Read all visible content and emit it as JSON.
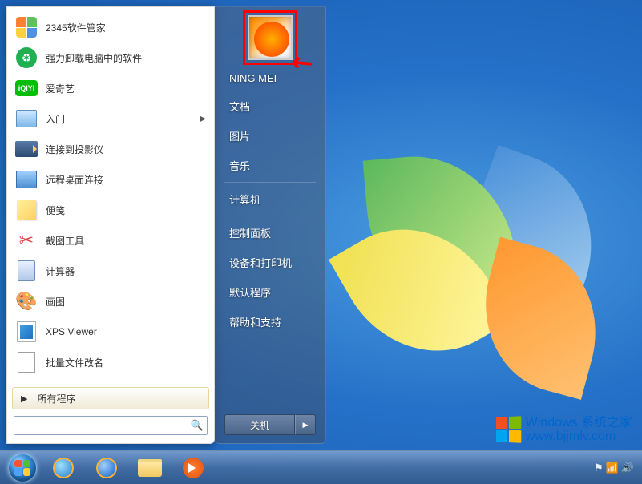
{
  "programs": [
    {
      "label": "2345软件管家",
      "icon": "2345-icon"
    },
    {
      "label": "强力卸载电脑中的软件",
      "icon": "uninstall-icon"
    },
    {
      "label": "爱奇艺",
      "icon": "iqiyi-icon"
    },
    {
      "label": "入门",
      "icon": "getting-started-icon",
      "submenu": true
    },
    {
      "label": "连接到投影仪",
      "icon": "projector-icon"
    },
    {
      "label": "远程桌面连接",
      "icon": "remote-desktop-icon"
    },
    {
      "label": "便笺",
      "icon": "sticky-notes-icon"
    },
    {
      "label": "截图工具",
      "icon": "snipping-tool-icon"
    },
    {
      "label": "计算器",
      "icon": "calculator-icon"
    },
    {
      "label": "画图",
      "icon": "paint-icon"
    },
    {
      "label": "XPS Viewer",
      "icon": "xps-viewer-icon"
    },
    {
      "label": "批量文件改名",
      "icon": "rename-icon"
    }
  ],
  "all_programs": "所有程序",
  "search": {
    "placeholder": ""
  },
  "right_panel": {
    "username": "NING MEI",
    "items_top": [
      "文档",
      "图片",
      "音乐"
    ],
    "items_mid": [
      "计算机"
    ],
    "items_bot": [
      "控制面板",
      "设备和打印机",
      "默认程序",
      "帮助和支持"
    ],
    "shutdown": "关机"
  },
  "taskbar_icons": [
    "ie-icon",
    "ie64-icon",
    "explorer-icon",
    "wmp-icon"
  ],
  "watermark": {
    "line1": "Windows 系统之家",
    "line2": "www.bjjmlv.com"
  }
}
